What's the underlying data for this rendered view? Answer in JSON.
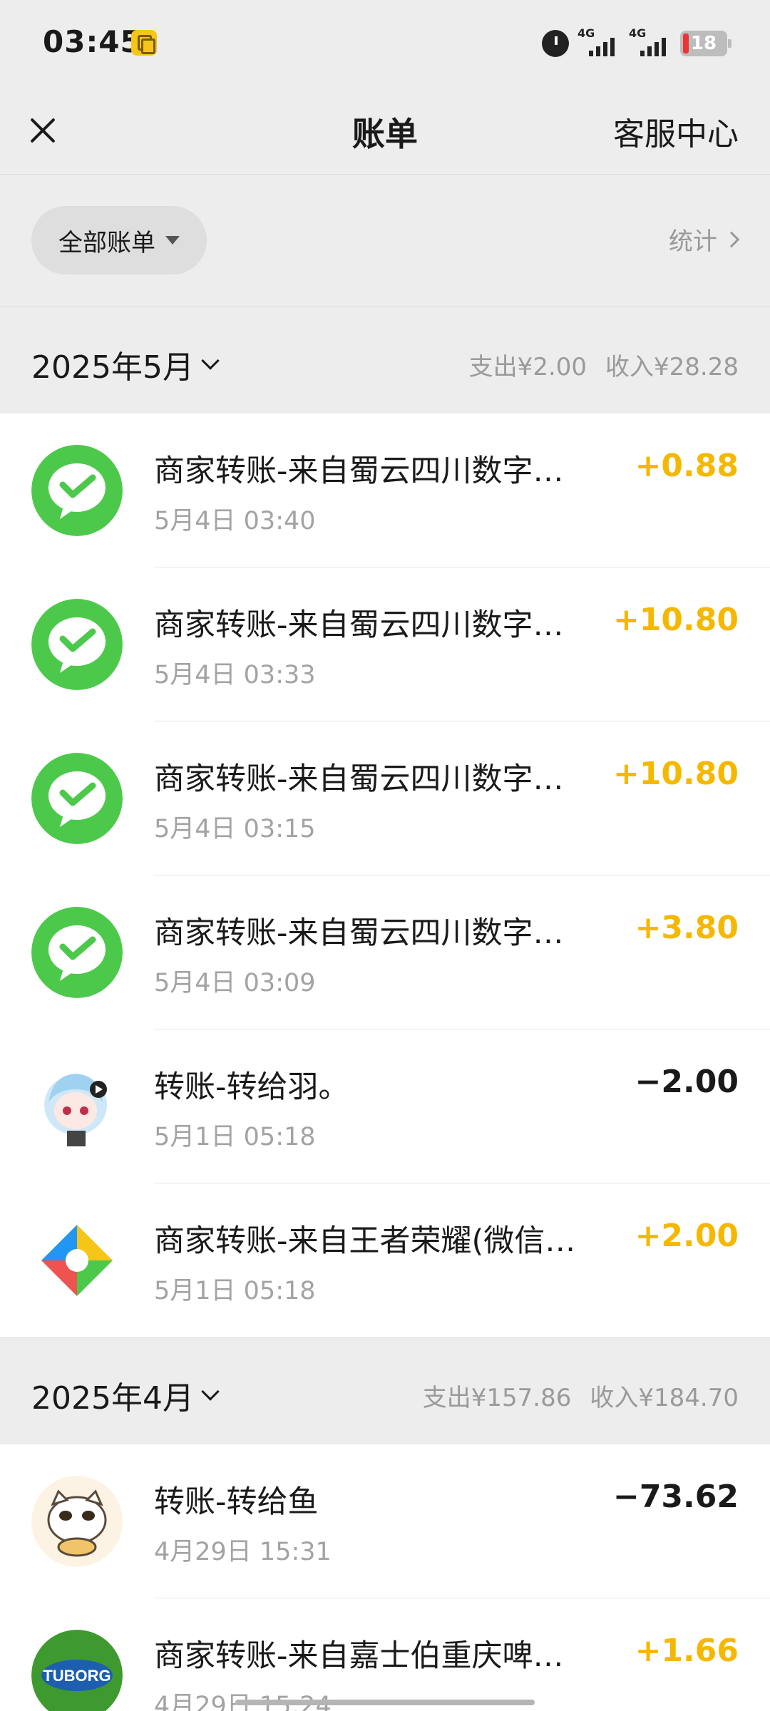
{
  "status_bar": {
    "time": "03:45",
    "network1": "4G",
    "network2": "4G",
    "battery": "18"
  },
  "nav": {
    "title": "账单",
    "service": "客服中心"
  },
  "filter": {
    "label": "全部账单",
    "stats": "统计"
  },
  "months": [
    {
      "title": "2025年5月",
      "expense": "支出¥2.00",
      "income": "收入¥28.28",
      "items": [
        {
          "title": "商家转账-来自蜀云四川数字…",
          "time": "5月4日 03:40",
          "amount": "+0.88",
          "icon": "wechat-pay-icon"
        },
        {
          "title": "商家转账-来自蜀云四川数字…",
          "time": "5月4日 03:33",
          "amount": "+10.80",
          "icon": "wechat-pay-icon"
        },
        {
          "title": "商家转账-来自蜀云四川数字…",
          "time": "5月4日 03:15",
          "amount": "+10.80",
          "icon": "wechat-pay-icon"
        },
        {
          "title": "商家转账-来自蜀云四川数字…",
          "time": "5月4日 03:09",
          "amount": "+3.80",
          "icon": "wechat-pay-icon"
        },
        {
          "title": "转账-转给羽。",
          "time": "5月1日 05:18",
          "amount": "−2.00",
          "icon": "anime-avatar"
        },
        {
          "title": "商家转账-来自王者荣耀(微信…",
          "time": "5月1日 05:18",
          "amount": "+2.00",
          "icon": "game-logo-icon"
        }
      ]
    },
    {
      "title": "2025年4月",
      "expense": "支出¥157.86",
      "income": "收入¥184.70",
      "items": [
        {
          "title": "转账-转给鱼",
          "time": "4月29日 15:31",
          "amount": "−73.62",
          "icon": "cat-avatar"
        },
        {
          "title": "商家转账-来自嘉士伯重庆啤…",
          "time": "4月29日 15:24",
          "amount": "+1.66",
          "icon": "tuborg-logo",
          "logo_text": "TUBORG"
        }
      ]
    }
  ],
  "colors": {
    "income": "#f5b800",
    "expense": "#1a1a1a",
    "wechat_green": "#4cc94b"
  }
}
